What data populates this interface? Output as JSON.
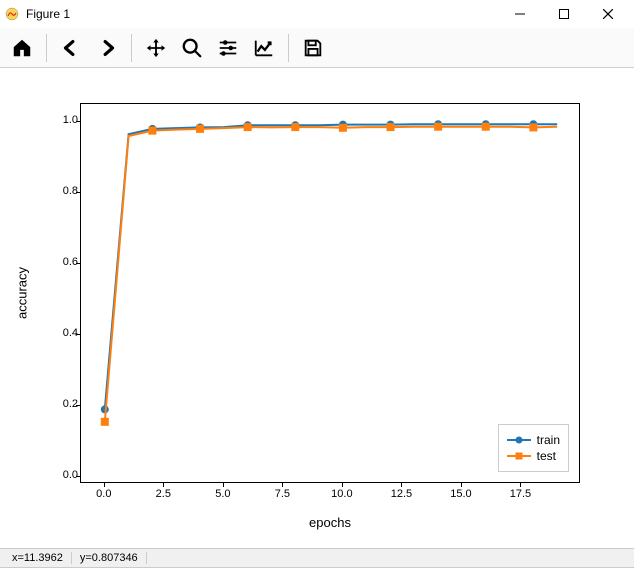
{
  "window": {
    "title": "Figure 1"
  },
  "toolbar": {
    "home": "Home",
    "back": "Back",
    "forward": "Forward",
    "pan": "Pan",
    "zoom": "Zoom",
    "configure": "Configure subplots",
    "edit": "Edit axis",
    "save": "Save"
  },
  "statusbar": {
    "x": "x=11.3962",
    "y": "y=0.807346"
  },
  "chart_data": {
    "type": "line",
    "xlabel": "epochs",
    "ylabel": "accuracy",
    "xlim": [
      -1,
      20
    ],
    "ylim": [
      -0.02,
      1.05
    ],
    "xticks": [
      0.0,
      2.5,
      5.0,
      7.5,
      10.0,
      12.5,
      15.0,
      17.5
    ],
    "yticks": [
      0.0,
      0.2,
      0.4,
      0.6,
      0.8,
      1.0
    ],
    "series": [
      {
        "name": "train",
        "color": "#1f77b4",
        "marker": "circle",
        "x": [
          0,
          1,
          2,
          3,
          4,
          5,
          6,
          7,
          8,
          9,
          10,
          11,
          12,
          13,
          14,
          15,
          16,
          17,
          18,
          19
        ],
        "y": [
          0.19,
          0.965,
          0.98,
          0.982,
          0.984,
          0.985,
          0.99,
          0.99,
          0.99,
          0.99,
          0.992,
          0.992,
          0.992,
          0.993,
          0.993,
          0.993,
          0.993,
          0.993,
          0.993,
          0.993
        ]
      },
      {
        "name": "test",
        "color": "#ff7f0e",
        "marker": "square",
        "x": [
          0,
          1,
          2,
          3,
          4,
          5,
          6,
          7,
          8,
          9,
          10,
          11,
          12,
          13,
          14,
          15,
          16,
          17,
          18,
          19
        ],
        "y": [
          0.155,
          0.96,
          0.975,
          0.978,
          0.98,
          0.982,
          0.985,
          0.984,
          0.985,
          0.985,
          0.983,
          0.985,
          0.985,
          0.986,
          0.986,
          0.986,
          0.986,
          0.986,
          0.984,
          0.986
        ]
      }
    ],
    "legend": [
      "train",
      "test"
    ]
  }
}
